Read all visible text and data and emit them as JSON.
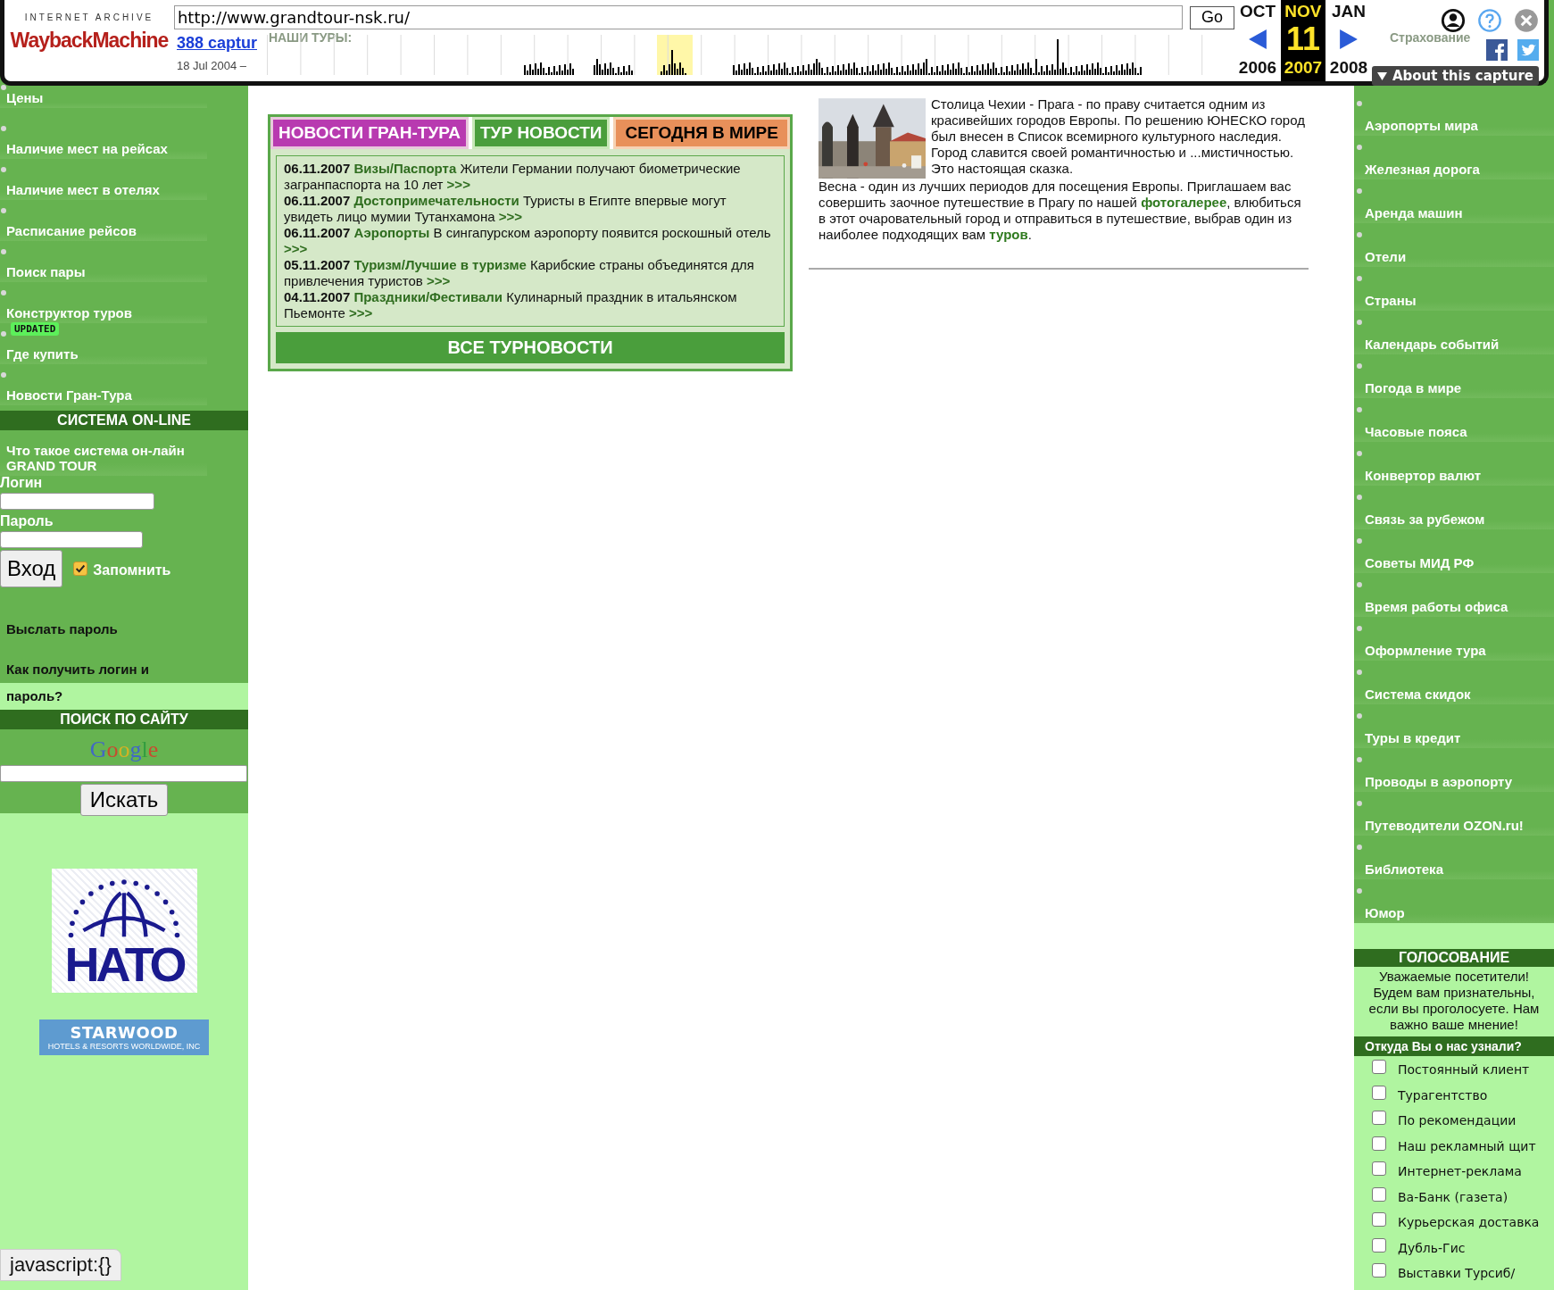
{
  "wayback": {
    "brand_top": "INTERNET ARCHIVE",
    "brand": "WaybackMachine",
    "url": "http://www.grandtour-nsk.ru/",
    "go": "Go",
    "captures": "388 captur",
    "since": "18 Jul 2004 –",
    "months": [
      {
        "month": "OCT",
        "year": "2006",
        "selected": false
      },
      {
        "month": "NOV",
        "day": "11",
        "year": "2007",
        "selected": true
      },
      {
        "month": "JAN",
        "year": "2008",
        "selected": false
      }
    ],
    "about": "About this capture"
  },
  "underlay": {
    "left": "НАШИ ТУРЫ:",
    "right": "Страхование"
  },
  "left_menu": [
    {
      "label": "Цены"
    },
    {
      "label": "Наличие мест на рейсах"
    },
    {
      "label": "Наличие мест в отелях"
    },
    {
      "label": "Расписание рейсов"
    },
    {
      "label": "Поиск пары"
    },
    {
      "label": "Конструктор туров",
      "badge": "UPDATED"
    },
    {
      "label": "Где купить"
    },
    {
      "label": "Новости Гран-Тура"
    }
  ],
  "online": {
    "title": "СИСТЕМА ON-LINE",
    "link": "Что такое система он-лайн GRAND TOUR",
    "login_label": "Логин",
    "password_label": "Пароль",
    "submit": "Вход",
    "remember": {
      "label": "Запомнить",
      "checked": true
    },
    "links": [
      "Выслать пароль",
      "Как получить логин и пароль?"
    ]
  },
  "search": {
    "title": "ПОИСК ПО САЙТУ",
    "logo": "Google",
    "button": "Искать"
  },
  "partners": [
    {
      "kind": "globe",
      "name": "НАТО"
    },
    {
      "kind": "banner",
      "name": "STARWOOD",
      "tagline": "HOTELS & RESORTS WORLDWIDE, INC"
    }
  ],
  "status_tip": "javascript:{}",
  "news_tabs": [
    {
      "label": "НОВОСТИ ГРАН-ТУРА",
      "color": "#b83ab0"
    },
    {
      "label": "ТУР НОВОСТИ",
      "color": "#4a9e3c"
    },
    {
      "label": "СЕГОДНЯ В МИРЕ",
      "color": "#e8905a"
    }
  ],
  "news": [
    {
      "date": "06.11.2007",
      "category": "Визы/Паспорта",
      "text": "Жители Германии получают биометрические загранпаспорта на 10 лет",
      "more": ">>>"
    },
    {
      "date": "06.11.2007",
      "category": "Достопримечательности",
      "text": "Туристы в Египте впервые могут увидеть лицо мумии Тутанхамона",
      "more": ">>>"
    },
    {
      "date": "06.11.2007",
      "category": "Аэропорты",
      "text": "В сингапурском аэропорту появится роскошный отель",
      "more": ">>>"
    },
    {
      "date": "05.11.2007",
      "category": "Туризм/Лучшие в туризме",
      "text": "Карибские страны объединятся для привлечения туристов",
      "more": ">>>"
    },
    {
      "date": "04.11.2007",
      "category": "Праздники/Фестивали",
      "text": "Кулинарный праздник в итальянском Пьемонте",
      "more": ">>>"
    }
  ],
  "news_all": "ВСЕ ТУРНОВОСТИ",
  "article": {
    "picture": {
      "kind": "picture"
    },
    "paragraphs": [
      [
        {
          "text": "Столица Чехии - Прага - по праву считается одним из красивейших городов Европы. По решению ЮНЕСКО город был внесен в Список всемирного культурного наследия."
        }
      ],
      [
        {
          "text": "Город славится своей романтичностью и ...мистичностью. Это настоящая сказка."
        }
      ],
      [
        {
          "text": "Весна - один из лучших периодов для посещения Европы. Приглашаем вас совершить заочное путешествие в Прагу по нашей "
        },
        {
          "link": "фотогалерее"
        },
        {
          "text": ", влюбиться в этот очаровательный город и отправиться в путешествие, выбрав один из наиболее подходящих вам "
        },
        {
          "link": "туров"
        },
        {
          "text": "."
        }
      ]
    ]
  },
  "right_menu": [
    "Аэропорты мира",
    "Железная дорога",
    "Аренда машин",
    "Отели",
    "Страны",
    "Календарь событий",
    "Погода в мире",
    "Часовые пояса",
    "Конвертор валют",
    "Связь за рубежом",
    "Советы МИД РФ",
    "Время работы офиса",
    "Оформление тура",
    "Система скидок",
    "Туры в кредит",
    "Проводы в аэропорту",
    "Путеводители OZON.ru!",
    "Библиотека",
    "Юмор"
  ],
  "poll": {
    "title": "ГОЛОСОВАНИЕ",
    "intro": "Уважаемые посетители! Будем вам признательны, если вы проголосуете. Нам важно ваше мнение!",
    "question": "Откуда Вы о нас узнали?",
    "options": [
      {
        "label": "Постоянный клиент",
        "checked": false
      },
      {
        "label": "Турагентство",
        "checked": false
      },
      {
        "label": "По рекомендации",
        "checked": false
      },
      {
        "label": "Наш рекламный щит",
        "checked": false
      },
      {
        "label": "Интернет-реклама",
        "checked": false
      },
      {
        "label": "Ва-Банк (газета)",
        "checked": false
      },
      {
        "label": "Курьерская доставка",
        "checked": false
      },
      {
        "label": "Дубль-Гис",
        "checked": false
      },
      {
        "label": "Выставки Турсиб/",
        "checked": false
      }
    ]
  }
}
